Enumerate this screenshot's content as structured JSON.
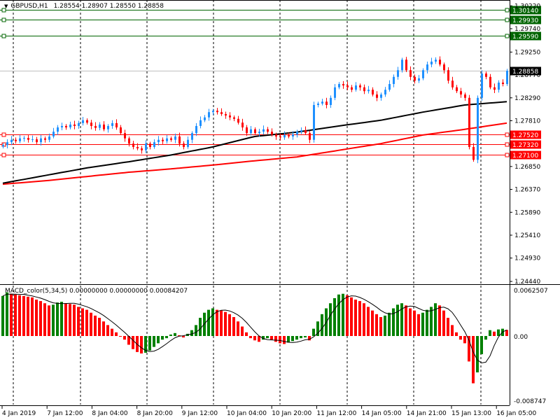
{
  "header": {
    "symbol": "GBPUSD,H1",
    "ohlc": "1.28554 1.28907 1.28550 1.28858"
  },
  "macd_header": {
    "label": "MACD_color(5,34,5) 0.00000000 0.00000000 0.00084207"
  },
  "price_axis": {
    "ticks": [
      "1.30220",
      "1.29740",
      "1.29250",
      "1.28770",
      "1.28290",
      "1.27810",
      "1.26850",
      "1.26370",
      "1.25890",
      "1.25410",
      "1.24930",
      "1.24440"
    ],
    "tick_values": [
      1.3022,
      1.2974,
      1.2925,
      1.2877,
      1.2829,
      1.2781,
      1.2685,
      1.2637,
      1.2589,
      1.2541,
      1.2493,
      1.2444
    ]
  },
  "levels": [
    {
      "label": "1.30140",
      "value": 1.3014,
      "color": "#006400"
    },
    {
      "label": "1.29930",
      "value": 1.2993,
      "color": "#006400"
    },
    {
      "label": "1.29590",
      "value": 1.2959,
      "color": "#006400"
    },
    {
      "label": "1.27520",
      "value": 1.2752,
      "color": "#ff0000"
    },
    {
      "label": "1.27320",
      "value": 1.2732,
      "color": "#ff0000"
    },
    {
      "label": "1.27100",
      "value": 1.271,
      "color": "#ff0000"
    }
  ],
  "current_price": {
    "label": "1.28858",
    "value": 1.28858
  },
  "macd_axis": {
    "top": "0.0062507",
    "zero": "0.00",
    "bottom": "-0.008747"
  },
  "time_axis": [
    "4 Jan 2019",
    "7 Jan 12:00",
    "8 Jan 04:00",
    "8 Jan 20:00",
    "9 Jan 12:00",
    "10 Jan 04:00",
    "10 Jan 20:00",
    "11 Jan 12:00",
    "14 Jan 05:00",
    "14 Jan 21:00",
    "15 Jan 13:00",
    "16 Jan 05:00"
  ],
  "colors": {
    "up": "#1e90ff",
    "down": "#ff0000",
    "ma_fast": "#000000",
    "ma_slow": "#ff0000",
    "macd_up": "#008000",
    "macd_down": "#ff0000"
  },
  "chart_data": {
    "type": "candlestick",
    "closes": [
      1.273,
      1.2736,
      1.2741,
      1.2738,
      1.2744,
      1.2745,
      1.2741,
      1.2742,
      1.2736,
      1.2744,
      1.2741,
      1.2748,
      1.2758,
      1.2767,
      1.277,
      1.2767,
      1.2773,
      1.277,
      1.2776,
      1.2782,
      1.2777,
      1.277,
      1.2766,
      1.2773,
      1.2763,
      1.277,
      1.2776,
      1.2767,
      1.2755,
      1.2744,
      1.2733,
      1.2726,
      1.2723,
      1.2719,
      1.2733,
      1.2726,
      1.2736,
      1.2741,
      1.2738,
      1.2744,
      1.2741,
      1.2748,
      1.2733,
      1.2726,
      1.2741,
      1.2755,
      1.277,
      1.2782,
      1.2788,
      1.2799,
      1.2802,
      1.2799,
      1.2795,
      1.2792,
      1.2788,
      1.2785,
      1.2777,
      1.2767,
      1.2755,
      1.2763,
      1.2755,
      1.2758,
      1.2763,
      1.2758,
      1.2752,
      1.2748,
      1.2746,
      1.2751,
      1.2748,
      1.2752,
      1.2758,
      1.2761,
      1.2755,
      1.2741,
      1.2814,
      1.2817,
      1.2821,
      1.2814,
      1.2829,
      1.2851,
      1.2858,
      1.2855,
      1.2851,
      1.2846,
      1.2855,
      1.2851,
      1.2843,
      1.2846,
      1.2836,
      1.2829,
      1.2836,
      1.2846,
      1.2858,
      1.2873,
      1.2887,
      1.2909,
      1.2887,
      1.2873,
      1.2865,
      1.287,
      1.2887,
      1.2899,
      1.2905,
      1.2909,
      1.2899,
      1.2887,
      1.2865,
      1.2851,
      1.2843,
      1.2836,
      1.2829,
      1.2726,
      1.2699,
      1.2829,
      1.288,
      1.2873,
      1.2851,
      1.2846,
      1.2861,
      1.2858,
      1.28858
    ],
    "ma_black_every10": [
      1.265,
      1.2666,
      1.2682,
      1.2695,
      1.2709,
      1.2726,
      1.2748,
      1.2757,
      1.277,
      1.2782,
      1.2799,
      1.2814,
      1.2821
    ],
    "ma_red_every10": [
      1.2648,
      1.2655,
      1.2664,
      1.2673,
      1.268,
      1.2688,
      1.2697,
      1.2705,
      1.2719,
      1.2733,
      1.2751,
      1.2763,
      1.2776
    ],
    "macd_hist_x1000": [
      5.5,
      6.0,
      5.8,
      5.7,
      5.6,
      5.5,
      5.4,
      5.3,
      5.0,
      4.8,
      4.5,
      4.2,
      4.3,
      4.6,
      4.7,
      4.5,
      4.4,
      4.3,
      4.0,
      3.8,
      3.6,
      3.2,
      2.8,
      2.5,
      2.0,
      1.5,
      1.0,
      0.5,
      0,
      -0.5,
      -1.2,
      -1.8,
      -2.2,
      -2.4,
      -2.3,
      -2.0,
      -1.5,
      -1.0,
      -0.5,
      -0.3,
      0.2,
      0.4,
      0.1,
      -0.2,
      0.3,
      0.8,
      1.5,
      2.5,
      3.2,
      3.6,
      3.8,
      3.6,
      3.5,
      3.3,
      3.0,
      2.6,
      2.0,
      1.3,
      0.5,
      -0.3,
      -0.6,
      -0.8,
      -0.5,
      -0.3,
      -0.5,
      -0.8,
      -1.0,
      -1.1,
      -0.9,
      -0.7,
      -0.5,
      -0.3,
      -0.2,
      -0.6,
      1.0,
      2.0,
      3.0,
      3.8,
      4.5,
      5.2,
      5.7,
      5.8,
      5.6,
      5.3,
      5.0,
      4.8,
      4.5,
      4.0,
      3.5,
      3.0,
      2.6,
      2.8,
      3.2,
      3.8,
      4.3,
      4.5,
      4.2,
      3.8,
      3.5,
      3.0,
      3.2,
      3.6,
      4.0,
      4.5,
      4.2,
      3.5,
      2.5,
      1.5,
      0.5,
      -0.5,
      -1.0,
      -3.5,
      -6.5,
      -5.0,
      -2.5,
      -0.5,
      0.8,
      0.6,
      0.9,
      1.0,
      0.84
    ],
    "price_range": [
      1.2444,
      1.3022
    ],
    "macd_range": [
      -0.008747,
      0.0062507
    ]
  }
}
